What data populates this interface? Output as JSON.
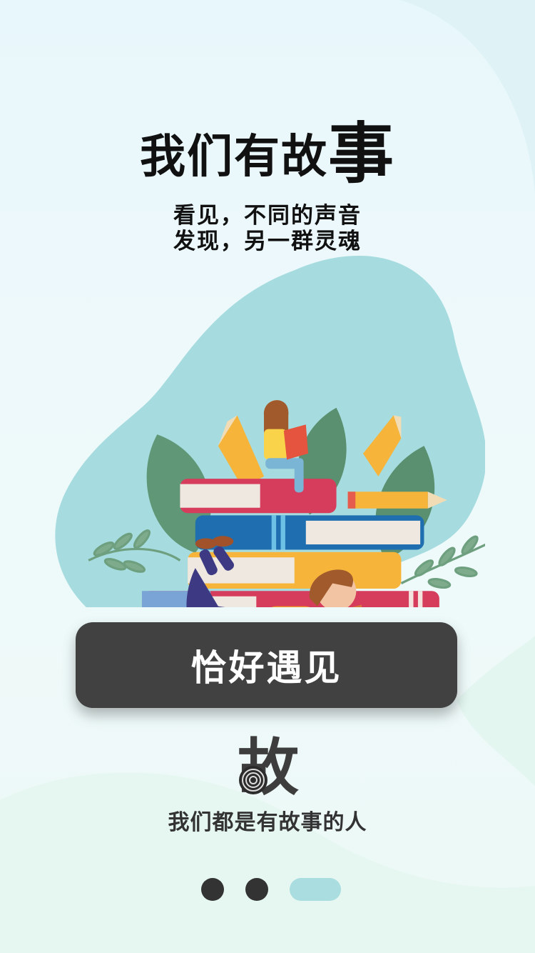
{
  "headline": {
    "prefix": "我们有故",
    "emphasis": "事"
  },
  "subtitle": {
    "line1": "看见，不同的声音",
    "line2": "发现，另一群灵魂"
  },
  "cta": {
    "label": "恰好遇见"
  },
  "logo": {
    "char": "故"
  },
  "tagline": "我们都是有故事的人",
  "pagination": {
    "total": 3,
    "active_index": 3
  },
  "colors": {
    "accent_teal": "#a9dde0",
    "button_bg": "#414141",
    "text_dark": "#111111",
    "leaf_green": "#5a8f6f"
  }
}
